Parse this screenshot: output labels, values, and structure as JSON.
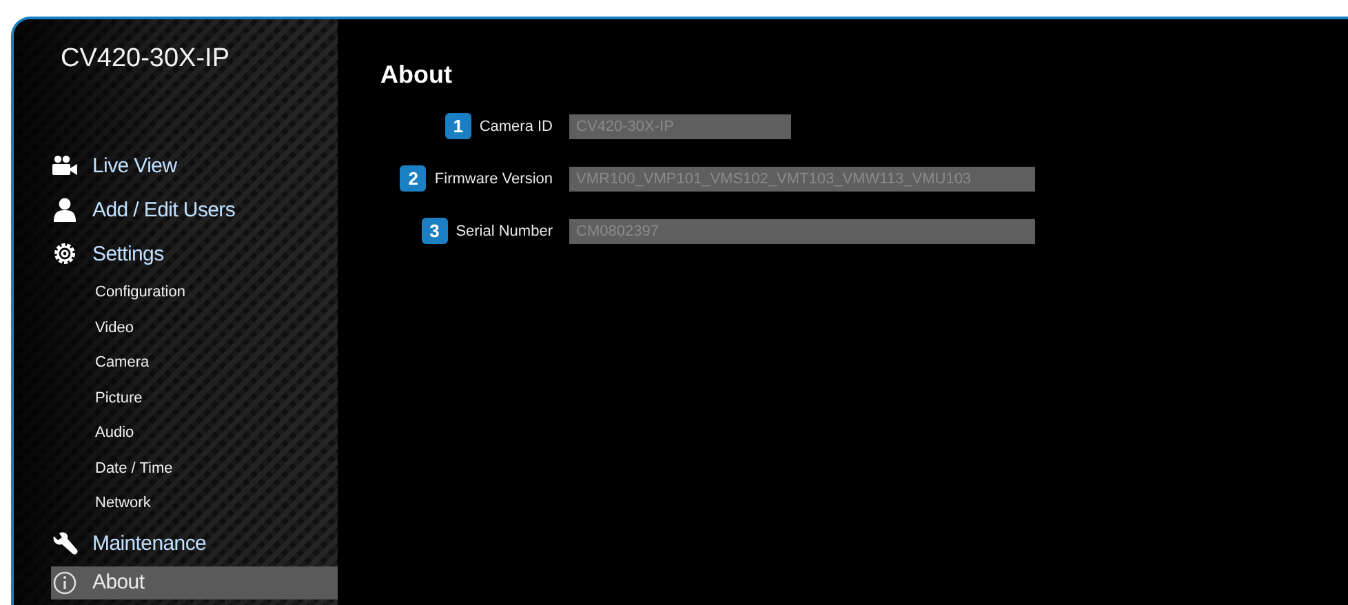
{
  "sidebar": {
    "title": "CV420-30X-IP",
    "items": [
      {
        "label": "Live View",
        "kind": "main",
        "selected": false
      },
      {
        "label": "Add / Edit Users",
        "kind": "main",
        "selected": false
      },
      {
        "label": "Settings",
        "kind": "main",
        "selected": false
      },
      {
        "label": "Configuration",
        "kind": "sub",
        "selected": false
      },
      {
        "label": "Video",
        "kind": "sub",
        "selected": false
      },
      {
        "label": "Camera",
        "kind": "sub",
        "selected": false
      },
      {
        "label": "Picture",
        "kind": "sub",
        "selected": false
      },
      {
        "label": "Audio",
        "kind": "sub",
        "selected": false
      },
      {
        "label": "Date / Time",
        "kind": "sub",
        "selected": false
      },
      {
        "label": "Network",
        "kind": "sub",
        "selected": false
      },
      {
        "label": "Maintenance",
        "kind": "main",
        "selected": false
      },
      {
        "label": "About",
        "kind": "main",
        "selected": true
      }
    ]
  },
  "main": {
    "heading": "About",
    "fields": [
      {
        "badge": "1",
        "label": "Camera ID",
        "value": "CV420-30X-IP"
      },
      {
        "badge": "2",
        "label": "Firmware Version",
        "value": "VMR100_VMP101_VMS102_VMT103_VMW113_VMU103"
      },
      {
        "badge": "3",
        "label": "Serial Number",
        "value": "CM0802397"
      }
    ]
  }
}
